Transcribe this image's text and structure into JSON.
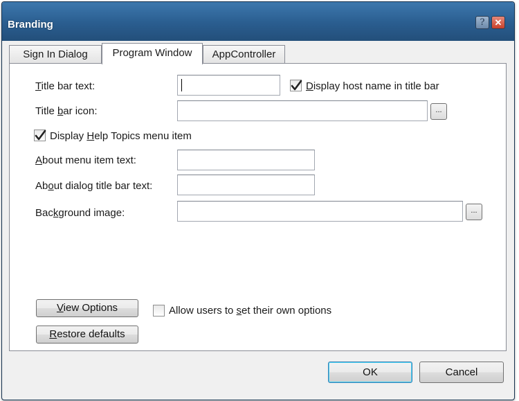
{
  "window": {
    "title": "Branding"
  },
  "titlebar": {
    "help_glyph": "?",
    "close_glyph": "✕"
  },
  "tabs": [
    {
      "label": "Sign In Dialog",
      "active": false
    },
    {
      "label": "Program Window",
      "active": true
    },
    {
      "label": "AppController",
      "active": false
    }
  ],
  "form": {
    "title_bar_text": {
      "label_accel": "T",
      "label_rest": "itle bar text:",
      "value": ""
    },
    "display_host_name": {
      "checked": true,
      "label_accel": "D",
      "label_rest": "isplay host name in title bar"
    },
    "title_bar_icon": {
      "label_pre": "Title ",
      "label_accel": "b",
      "label_rest": "ar icon:",
      "value": ""
    },
    "display_help_topics": {
      "checked": true,
      "label_pre": "Display ",
      "label_accel": "H",
      "label_rest": "elp Topics menu item"
    },
    "about_menu_item_text": {
      "label_accel": "A",
      "label_rest": "bout menu item text:",
      "value": ""
    },
    "about_dialog_title": {
      "label_pre": "Ab",
      "label_accel": "o",
      "label_rest": "ut dialog title bar text:",
      "value": ""
    },
    "background_image": {
      "label_pre": "Bac",
      "label_accel": "k",
      "label_rest": "ground image:",
      "value": ""
    },
    "browse_label": "...",
    "view_options": {
      "label_accel": "V",
      "label_rest": "iew Options"
    },
    "allow_users": {
      "checked": false,
      "label_pre": "Allow users to ",
      "label_accel": "s",
      "label_rest": "et their own options"
    },
    "restore_defaults": {
      "label_accel": "R",
      "label_rest": "estore defaults"
    }
  },
  "footer": {
    "ok_label": "OK",
    "cancel_label": "Cancel"
  },
  "colors": {
    "titlebar": "#2a5d8f",
    "close_button": "#c8402a",
    "ok_focus": "#48d3f6"
  }
}
